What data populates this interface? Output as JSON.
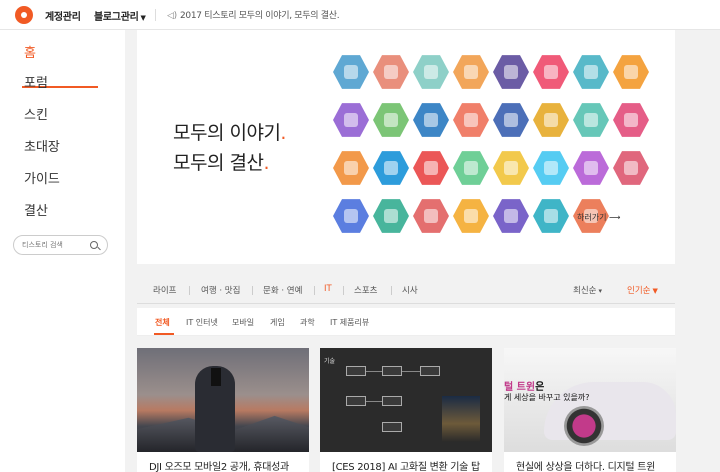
{
  "topbar": {
    "account_label": "계정관리",
    "blog_label": "블로그관리",
    "notice": "2017 티스토리 모두의 이야기, 모두의 결산."
  },
  "sidebar": {
    "items": [
      {
        "label": "홈"
      },
      {
        "label": "포럼"
      },
      {
        "label": "스킨"
      },
      {
        "label": "초대장"
      },
      {
        "label": "가이드"
      },
      {
        "label": "결산"
      }
    ],
    "search_placeholder": "티스토리 검색"
  },
  "hero": {
    "line1": "모두의 이야기",
    "line2": "모두의 결산",
    "more": "하러가기 ⟶",
    "icon_colors": [
      [
        "#5fa8d3",
        "#e98f7c",
        "#8ed0c8",
        "#f2a65a",
        "#6b5ca5",
        "#f05a78",
        "#58b9c9",
        "#f4a340"
      ],
      [
        "#9b6ed6",
        "#7cc576",
        "#3d86c6",
        "#f07f6a",
        "#4c6fb8",
        "#e8b23d",
        "#66c7b8",
        "#e55d87"
      ],
      [
        "#f2994a",
        "#2d9cdb",
        "#eb5757",
        "#6fcf97",
        "#f2c94c",
        "#56ccf2",
        "#bb6bd9",
        "#e0677d"
      ],
      [
        "#5b7ee0",
        "#48b59c",
        "#e46f6f",
        "#f5b342",
        "#7a64c9",
        "#3fb5c7",
        "#ec7f5c"
      ]
    ]
  },
  "tabs": {
    "items": [
      "라이프",
      "여행 · 맛집",
      "문화 · 연예",
      "IT",
      "스포츠",
      "시사"
    ],
    "sort": [
      "최신순",
      "인기순"
    ]
  },
  "subtabs": {
    "items": [
      "전체",
      "IT 인터넷",
      "모바일",
      "게임",
      "과학",
      "IT 제품리뷰"
    ]
  },
  "cards": [
    {
      "title": "DJI 오즈모 모바일2 공개, 휴대성과"
    },
    {
      "title": "[CES 2018] AI 고화질 변환 기술 탑",
      "img_text": "기술"
    },
    {
      "title": "현실에 상상을 더하다. 디지털 트윈",
      "img_line1_prefix": "털 트윈",
      "img_line1_suffix": "은",
      "img_line2": "게 세상을 바꾸고 있을까?"
    }
  ]
}
